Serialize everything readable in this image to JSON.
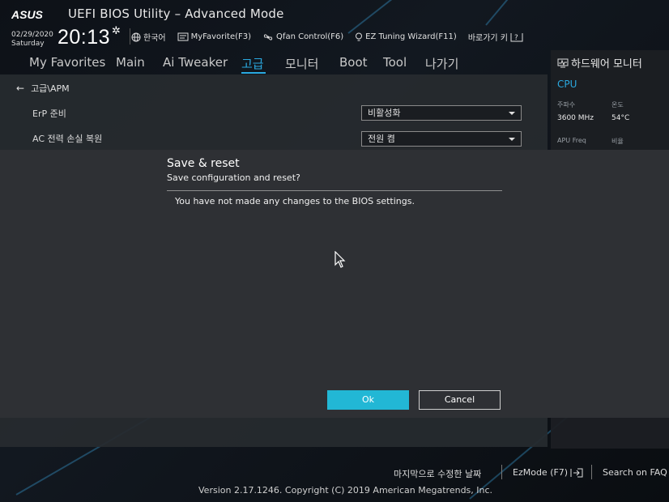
{
  "header": {
    "brand": "ASUS",
    "title": "UEFI BIOS Utility – Advanced Mode",
    "date": "02/29/2020",
    "day": "Saturday",
    "time": "20:13",
    "tools": [
      {
        "label": "한국어",
        "icon": "globe-icon"
      },
      {
        "label": "MyFavorite(F3)",
        "icon": "myfavorite-icon"
      },
      {
        "label": "Qfan Control(F6)",
        "icon": "fan-icon"
      },
      {
        "label": "EZ Tuning Wizard(F11)",
        "icon": "lightbulb-icon"
      },
      {
        "label": "바로가기 키",
        "icon": "help-key-icon"
      }
    ]
  },
  "nav": {
    "items": [
      "My Favorites",
      "Main",
      "Ai Tweaker",
      "고급",
      "모니터",
      "Boot",
      "Tool",
      "나가기"
    ],
    "active": "고급"
  },
  "main": {
    "breadcrumb": "고급\\APM",
    "settings": [
      {
        "label": "ErP 준비",
        "value": "비활성화"
      },
      {
        "label": "AC 전력 손실 복원",
        "value": "전원 켬"
      }
    ]
  },
  "hw_monitor": {
    "title": "하드웨어 모니터",
    "section": "CPU",
    "freq_label": "주파수",
    "freq_value": "3600 MHz",
    "temp_label": "온도",
    "temp_value": "54°C",
    "apu_label": "APU Freq",
    "ratio_label": "비율"
  },
  "modal": {
    "title": "Save & reset",
    "subtitle": "Save configuration and reset?",
    "message": "You have not made any changes to the BIOS settings.",
    "ok_label": "Ok",
    "cancel_label": "Cancel"
  },
  "footer": {
    "last_modified": "마지막으로 수정한 날짜",
    "ezmode": "EzMode (F7)",
    "search": "Search on FAQ",
    "version": "Version 2.17.1246. Copyright (C) 2019 American Megatrends, Inc."
  },
  "colors": {
    "accent": "#2aa9e0",
    "ok_button": "#22b7d5",
    "modal_bg": "#2e3034"
  }
}
